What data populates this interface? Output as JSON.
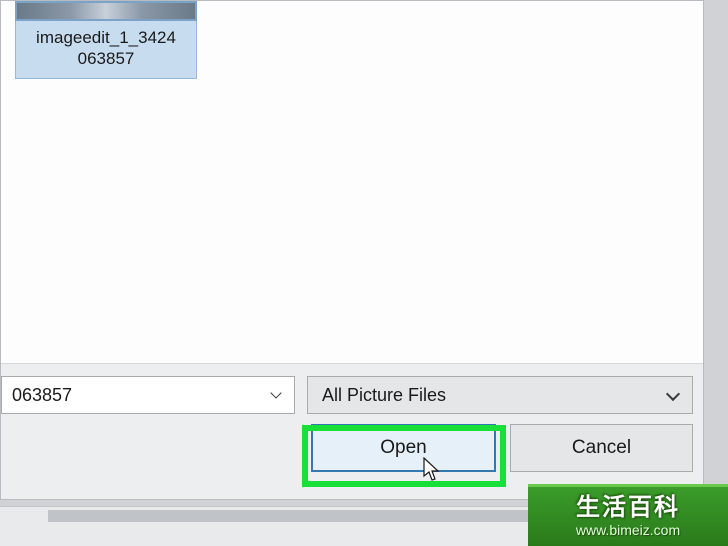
{
  "file": {
    "name_line1": "imageedit_1_3424",
    "name_line2": "063857"
  },
  "filename_input": {
    "value": "063857"
  },
  "filetype": {
    "selected": "All Picture Files"
  },
  "buttons": {
    "open": "Open",
    "cancel": "Cancel"
  },
  "watermark": {
    "title": "生活百科",
    "url": "www.bimeiz.com"
  }
}
